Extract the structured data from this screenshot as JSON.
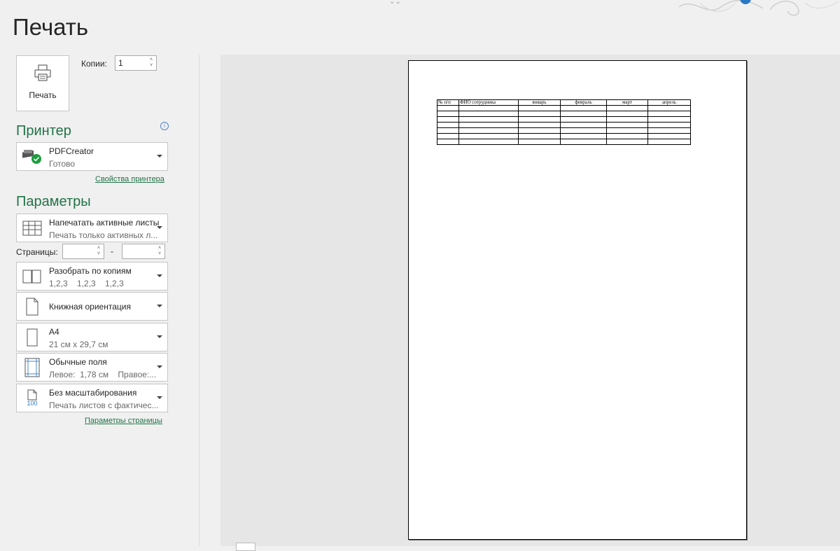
{
  "page_title": "Печать",
  "top_marks": "⌄⌄",
  "print_button": {
    "label": "Печать",
    "icon": "printer-icon"
  },
  "copies": {
    "label": "Копии:",
    "value": "1"
  },
  "printer_section": {
    "heading": "Принтер",
    "name": "PDFCreator",
    "status": "Готово",
    "properties_link": "Свойства принтера",
    "info_icon": "ⓘ"
  },
  "settings_section": {
    "heading": "Параметры",
    "what_to_print": {
      "line1": "Напечатать активные листы",
      "line2": "Печать только активных л..."
    },
    "pages_label": "Страницы:",
    "pages_from": "",
    "pages_to": "",
    "pages_dash": "-",
    "collation": {
      "line1": "Разобрать по копиям",
      "line2": "1,2,3    1,2,3    1,2,3"
    },
    "orientation": {
      "line1": "Книжная ориентация"
    },
    "paper": {
      "line1": "А4",
      "line2": "21 см x 29,7 см"
    },
    "margins": {
      "line1": "Обычные поля",
      "line2": "Левое:  1,78 см    Правое:..."
    },
    "scaling": {
      "line1": "Без масштабирования",
      "line2": "Печать листов с фактичес...",
      "icon_text": "100"
    },
    "page_setup_link": "Параметры страницы"
  },
  "preview": {
    "headers": [
      "№ п/п",
      "ФИО сотрудника",
      "январь",
      "февраль",
      "март",
      "апрель"
    ],
    "empty_rows": 7
  },
  "colors": {
    "accent": "#217346",
    "text": "#262626",
    "background": "#f0f0f0"
  }
}
